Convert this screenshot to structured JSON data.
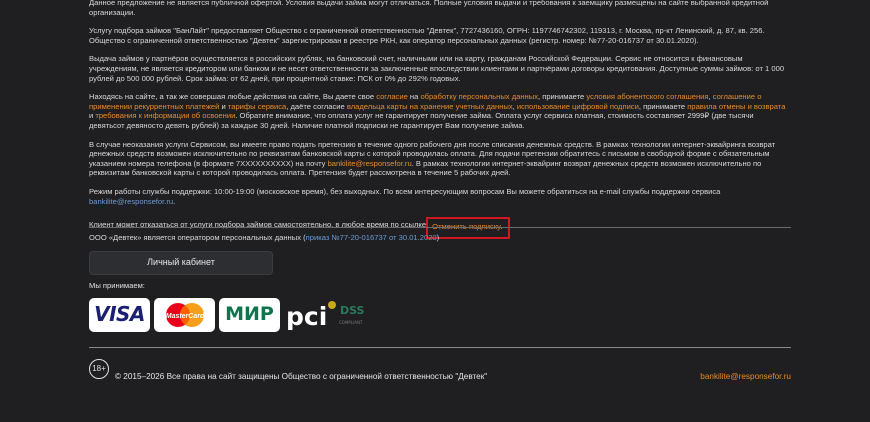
{
  "para_top": "Данное предложение не является публичной офертой. Условия выдачи займа могут отличаться. Полные условия выдачи и требования к заемщику размещены на сайте выбранной кредитной организации.",
  "para_service": "Услугу подбора займов \"БанЛайт\" предоставляет Общество с ограниченной ответственностью \"Девтек\", 7727436160, ОГРН: 1197746742302, 119313, г. Москва, пр-кт Ленинский, д. 87, кв. 256. Общество с ограниченной ответственностью \"Девтек\" зарегистрирован в реестре РКН, как оператор персональных данных (регистр. номер: №77-20-016737 от 30.01.2020).",
  "para_issue": "Выдача займов у партнёров осуществляется в российских рублях, на банковский счет, наличными или на карту, гражданам Российской Федерации. Сервис не относится к финансовым учреждениям, не является кредитором или банком и не несет ответственности за заключенные впоследствии клиентами и партнёрами договоры кредитования. Доступные суммы займов: от 1 000 рублей до 500 000 рублей. Срок займа: от 62 дней, при процентной ставке: ПСК от 0% до 292% годовых.",
  "consent": {
    "t1": "Находясь на сайте, а так же совершая любые действия на сайте, Вы даете свое ",
    "l1": "согласие",
    "t2": " на ",
    "l2": "обработку персональных данных",
    "t3": ", принимаете ",
    "l3": "условия абонентского соглашения",
    "t4": ", ",
    "l4": "соглашение о применении рекуррентных платежей",
    "t5": " и ",
    "l5": "тарифы сервиса",
    "t6": ", даёте согласие ",
    "l6": "владельца карты на хранение учетных данных",
    "t7": ", ",
    "l7": "использование цифровой подписи",
    "t8": ", принимаете ",
    "l8": "правила отмены и возврата",
    "t9": " и ",
    "l9": "требования к информации об освоении",
    "t10": ". Обратите внимание, что оплата услуг не гарантирует получение займа. Оплата услуг сервиса платная, стоимость составляет 2999₽ (две тысячи девятьсот девяносто девять рублей) за каждые 30 дней. Наличие платной подписки не гарантирует Вам получение займа."
  },
  "claim": {
    "t1": "В случае неоказания услуги Сервисом, вы имеете право подать претензию в течение одного рабочего дня после списания денежных средств. В рамках технологии интернет-эквайринга возврат денежных средств возможен исключительно по реквизитам банковской карты с которой проводилась оплата. Для подачи претензии обратитесь с письмом в свободной форме с обязательным указанием номера телефона (в формате 7XXXXXXXXXX) на почту ",
    "email": "bankilite@responsefor.ru",
    "t2": ". В рамках технологии интернет-эквайринг возврат денежных средств возможен исключительно по реквизитам банковской карты с которой проводилась оплата. Претензия будет рассмотрена в течение 5 рабочих дней."
  },
  "support": {
    "t1": "Режим работы службы поддержки: 10:00-19:00 (московское время), без выходных. По всем интересующим вопросам Вы можете обратиться на e-mail службы поддержки сервиса ",
    "email": "bankilite@responsefor.ru",
    "t2": "."
  },
  "cancel": {
    "text": "Клиент может отказаться от услуги подбора займов самостоятельно, в любое время по ссылке ",
    "link": "Отменить подписку",
    "dot": "."
  },
  "operator": {
    "text": "ООО «Девтек» является оператором персональных данных (",
    "link": "приказ №77-20-016737 от 30.01.2020",
    "close": ")"
  },
  "cabinet_button": "Личный кабинет",
  "accept_label": "Мы принимаем:",
  "payment_logos": [
    "VISA",
    "MasterCard",
    "МИР",
    "PCI DSS"
  ],
  "pci_text": "pci",
  "dss_text": "DSS",
  "compliant_text": "COMPLIANT",
  "footer": {
    "age": "18+",
    "copyright": "© 2015–2026 Все права на сайт защищены Общество с ограниченной ответственностью \"Девтек\"",
    "email": "bankilite@responsefor.ru"
  },
  "colors": {
    "background": "#1f1f21",
    "link": "#e88b2a",
    "highlight": "#d0191e"
  }
}
